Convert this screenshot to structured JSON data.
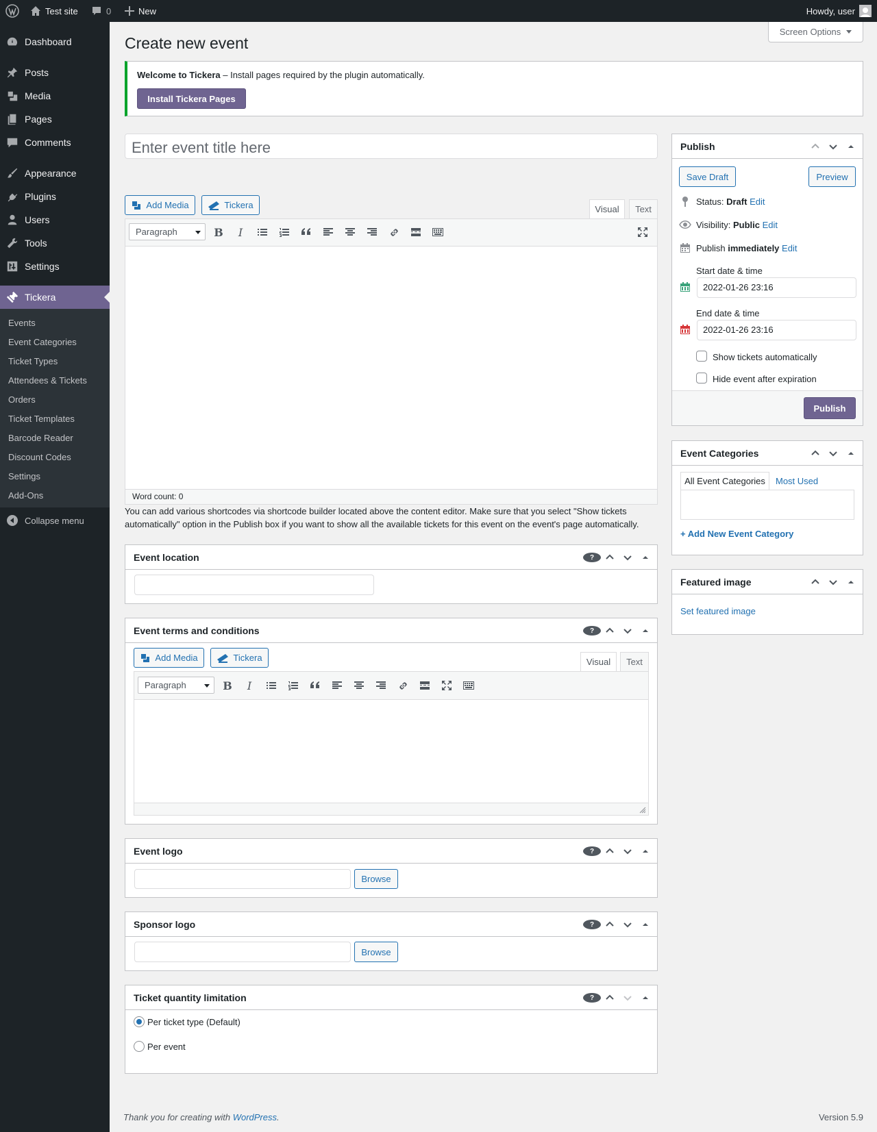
{
  "adminbar": {
    "site_name": "Test site",
    "comments_count": "0",
    "new_label": "New",
    "howdy": "Howdy, user"
  },
  "menu": {
    "items": [
      {
        "label": "Dashboard",
        "icon": "dashboard-icon"
      },
      {
        "label": "Posts",
        "icon": "pin-icon"
      },
      {
        "label": "Media",
        "icon": "media-icon"
      },
      {
        "label": "Pages",
        "icon": "pages-icon"
      },
      {
        "label": "Comments",
        "icon": "comment-icon"
      },
      {
        "label": "Appearance",
        "icon": "brush-icon"
      },
      {
        "label": "Plugins",
        "icon": "plugin-icon"
      },
      {
        "label": "Users",
        "icon": "user-icon"
      },
      {
        "label": "Tools",
        "icon": "wrench-icon"
      },
      {
        "label": "Settings",
        "icon": "settings-icon"
      },
      {
        "label": "Tickera",
        "icon": "ticket-icon"
      }
    ],
    "submenu": [
      "Events",
      "Event Categories",
      "Ticket Types",
      "Attendees & Tickets",
      "Orders",
      "Ticket Templates",
      "Barcode Reader",
      "Discount Codes",
      "Settings",
      "Add-Ons"
    ],
    "collapse": "Collapse menu"
  },
  "screen_options": "Screen Options",
  "page_title": "Create new event",
  "notice": {
    "bold": "Welcome to Tickera",
    "text": " – Install pages required by the plugin automatically.",
    "button": "Install Tickera Pages"
  },
  "title_placeholder": "Enter event title here",
  "editor": {
    "add_media": "Add Media",
    "tickera": "Tickera",
    "tab_visual": "Visual",
    "tab_text": "Text",
    "format": "Paragraph",
    "word_count": "Word count: 0"
  },
  "help_text": "You can add various shortcodes via shortcode builder located above the content editor. Make sure that you select \"Show tickets automatically\" option in the Publish box if you want to show all the available tickets for this event on the event's page automatically.",
  "boxes": {
    "location": "Event location",
    "terms": "Event terms and conditions",
    "logo": "Event logo",
    "sponsor": "Sponsor logo",
    "quantity": "Ticket quantity limitation",
    "browse": "Browse",
    "radio1": "Per ticket type (Default)",
    "radio2": "Per event"
  },
  "publish": {
    "title": "Publish",
    "save_draft": "Save Draft",
    "preview": "Preview",
    "status_label": "Status:",
    "status_value": "Draft",
    "visibility_label": "Visibility:",
    "visibility_value": "Public",
    "publish_label": "Publish",
    "publish_value": "immediately",
    "edit": "Edit",
    "start_label": "Start date & time",
    "start_value": "2022-01-26 23:16",
    "end_label": "End date & time",
    "end_value": "2022-01-26 23:16",
    "show_tickets": "Show tickets automatically",
    "hide_event": "Hide event after expiration",
    "publish_button": "Publish"
  },
  "categories": {
    "title": "Event Categories",
    "tab_all": "All Event Categories",
    "tab_most": "Most Used",
    "add_new": "+ Add New Event Category"
  },
  "featured": {
    "title": "Featured image",
    "link": "Set featured image"
  },
  "footer": {
    "thanks_prefix": "Thank you for creating with ",
    "wordpress": "WordPress",
    "thanks_suffix": ".",
    "version": "Version 5.9"
  },
  "colors": {
    "accent": "#6f6491",
    "link": "#2271b1",
    "sidebar": "#1d2327",
    "success": "#00a32a"
  }
}
